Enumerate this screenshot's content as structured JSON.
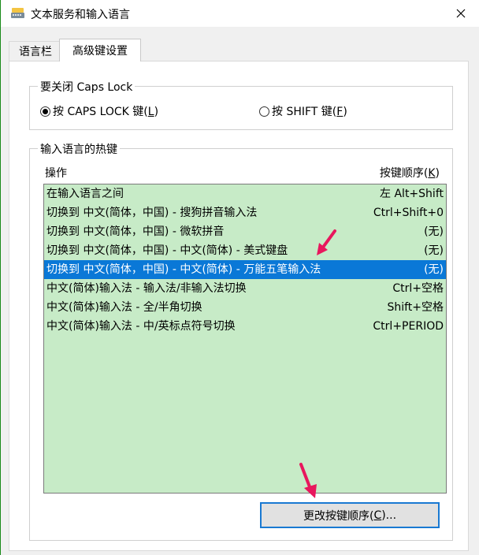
{
  "window": {
    "title": "文本服务和输入语言",
    "close_glyph": "✕"
  },
  "tabs": [
    {
      "label": "语言栏",
      "active": false
    },
    {
      "label": "高级键设置",
      "active": true
    }
  ],
  "caps_lock": {
    "group_label": "要关闭 Caps Lock",
    "options": [
      {
        "label": "按 CAPS LOCK 键(",
        "mnemonic": "L",
        "suffix": ")",
        "selected": true
      },
      {
        "label": "按 SHIFT 键(",
        "mnemonic": "F",
        "suffix": ")",
        "selected": false
      }
    ]
  },
  "hotkeys": {
    "group_label": "输入语言的热键",
    "header_action": "操作",
    "header_order": "按键顺序(",
    "header_order_mnemonic": "K",
    "header_order_suffix": ")",
    "rows": [
      {
        "action": "在输入语言之间",
        "keys": "左 Alt+Shift",
        "selected": false
      },
      {
        "action": "切换到 中文(简体，中国) - 搜狗拼音输入法",
        "keys": "Ctrl+Shift+0",
        "selected": false
      },
      {
        "action": "切换到 中文(简体，中国) - 微软拼音",
        "keys": "(无)",
        "selected": false
      },
      {
        "action": "切换到 中文(简体，中国) - 中文(简体) - 美式键盘",
        "keys": "(无)",
        "selected": false
      },
      {
        "action": "切换到 中文(简体，中国) - 中文(简体) - 万能五笔输入法",
        "keys": "(无)",
        "selected": true
      },
      {
        "action": "中文(简体)输入法 - 输入法/非输入法切换",
        "keys": "Ctrl+空格",
        "selected": false
      },
      {
        "action": "中文(简体)输入法 - 全/半角切换",
        "keys": "Shift+空格",
        "selected": false
      },
      {
        "action": "中文(简体)输入法 - 中/英标点符号切换",
        "keys": "Ctrl+PERIOD",
        "selected": false
      }
    ],
    "change_button": {
      "label": "更改按键顺序(",
      "mnemonic": "C",
      "suffix": ")..."
    }
  },
  "colors": {
    "list_background": "#c7ebc7",
    "selection": "#0a78d7",
    "annotation_arrow": "#e8175d"
  },
  "icons": {
    "app": "keyboard-icon",
    "close": "close-icon",
    "annotation": "pink-arrow-icon"
  }
}
